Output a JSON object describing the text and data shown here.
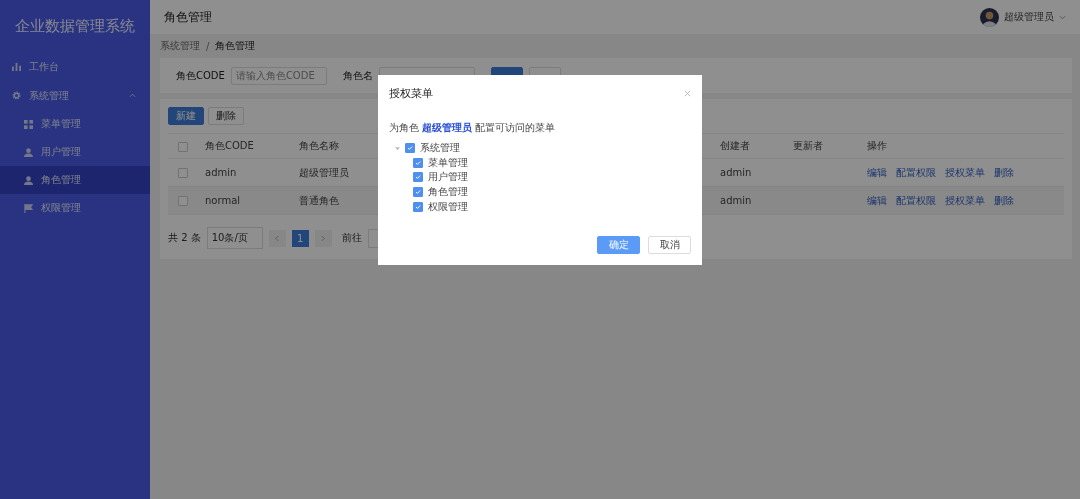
{
  "app_title": "企业数据管理系统",
  "sidebar": {
    "items": [
      {
        "label": "工作台",
        "selected": false
      },
      {
        "label": "系统管理",
        "selected": false,
        "expanded": true,
        "children": [
          {
            "label": "菜单管理",
            "selected": false
          },
          {
            "label": "用户管理",
            "selected": false
          },
          {
            "label": "角色管理",
            "selected": true
          },
          {
            "label": "权限管理",
            "selected": false
          }
        ]
      }
    ]
  },
  "header": {
    "page_title": "角色管理",
    "user": "超级管理员"
  },
  "breadcrumb": {
    "items": [
      "系统管理",
      "角色管理"
    ],
    "separator": "/"
  },
  "query": {
    "fields": [
      {
        "label": "角色CODE",
        "placeholder": "请输入角色CODE"
      },
      {
        "label": "角色名"
      }
    ]
  },
  "toolbar": [
    {
      "label": "新建",
      "kind": "primary"
    },
    {
      "label": "删除",
      "kind": "default"
    }
  ],
  "table": {
    "header_checked": false,
    "columns": [
      "角色CODE",
      "角色名称",
      "创建者",
      "更新者",
      "操作"
    ],
    "rows": [
      {
        "checked": false,
        "hovered": false,
        "cells": [
          "admin",
          "超级管理员",
          "admin"
        ],
        "actions": [
          "编辑",
          "配置权限",
          "授权菜单",
          "删除"
        ]
      },
      {
        "checked": false,
        "hovered": true,
        "cells": [
          "normal",
          "普通角色",
          "admin"
        ],
        "actions": [
          "编辑",
          "配置权限",
          "授权菜单",
          "删除"
        ]
      }
    ]
  },
  "pagination": {
    "total": "共 2 条",
    "page_size": "10条/页",
    "pages": [
      {
        "label": "1",
        "selected": true
      }
    ],
    "goto": "前往"
  },
  "dialog": {
    "title": "授权菜单",
    "message": "为角色 **超级管理员** 配置可访问的菜单",
    "tree": [
      {
        "label": "系统管理",
        "checked": true,
        "expanded": true,
        "children": [
          {
            "label": "菜单管理",
            "checked": true
          },
          {
            "label": "用户管理",
            "checked": true
          },
          {
            "label": "角色管理",
            "checked": true
          },
          {
            "label": "权限管理",
            "checked": true
          }
        ]
      }
    ],
    "buttons": [
      {
        "label": "确定",
        "kind": "primary"
      },
      {
        "label": "取消",
        "kind": "default"
      }
    ]
  }
}
